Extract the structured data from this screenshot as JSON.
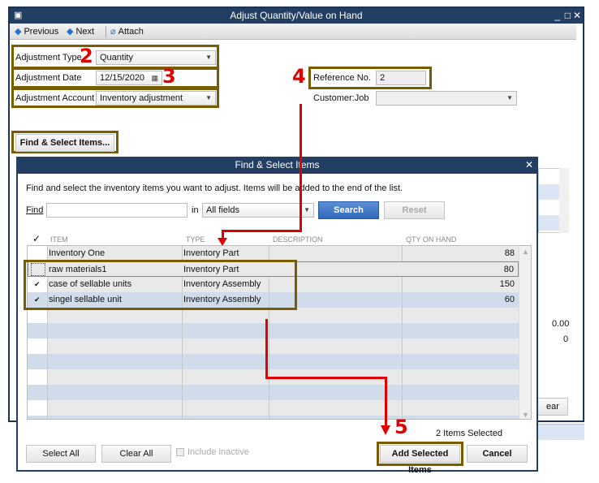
{
  "window": {
    "title": "Adjust Quantity/Value on Hand",
    "controls": [
      "_",
      "□",
      "✕"
    ]
  },
  "toolbar": {
    "previous": "Previous",
    "next": "Next",
    "attach": "Attach"
  },
  "form": {
    "adjustment_type_label": "Adjustment Type",
    "adjustment_type_value": "Quantity",
    "adjustment_date_label": "Adjustment Date",
    "adjustment_date_value": "12/15/2020",
    "adjustment_account_label": "Adjustment Account",
    "adjustment_account_value": "Inventory adjustment",
    "reference_label": "Reference No.",
    "reference_value": "2",
    "customer_job_label": "Customer:Job",
    "customer_job_value": "",
    "find_select_button": "Find & Select Items..."
  },
  "background_panel": {
    "total_value": "0.00",
    "total_qty": "0",
    "clear_button": "ear"
  },
  "annotations": {
    "step2": "2",
    "step3": "3",
    "step4": "4",
    "step5": "5",
    "colors": {
      "highlight": "#7a5c00",
      "arrow": "#e00000"
    }
  },
  "dialog": {
    "title": "Find & Select Items",
    "instructions": "Find and select the inventory items you want to adjust. Items will be added to the end of the list.",
    "find_label": "Find",
    "find_value": "",
    "in_label": "in",
    "in_value": "All fields",
    "search_button": "Search",
    "reset_button": "Reset",
    "columns": [
      "ITEM",
      "TYPE",
      "DESCRIPTION",
      "QTY ON HAND"
    ],
    "rows": [
      {
        "checked": false,
        "item": "Inventory One",
        "type": "Inventory Part",
        "description": "",
        "qty": "88"
      },
      {
        "checked": false,
        "item": "raw materials1",
        "type": "Inventory Part",
        "description": "",
        "qty": "80"
      },
      {
        "checked": true,
        "item": "case of sellable units",
        "type": "Inventory Assembly",
        "description": "",
        "qty": "150"
      },
      {
        "checked": true,
        "item": "singel sellable unit",
        "type": "Inventory Assembly",
        "description": "",
        "qty": "60"
      }
    ],
    "selected_count": "2 Items Selected",
    "select_all": "Select All",
    "clear_all": "Clear All",
    "include_inactive": "Include inactive",
    "add_selected": "Add Selected Items",
    "cancel": "Cancel",
    "check_mark": "✔"
  }
}
